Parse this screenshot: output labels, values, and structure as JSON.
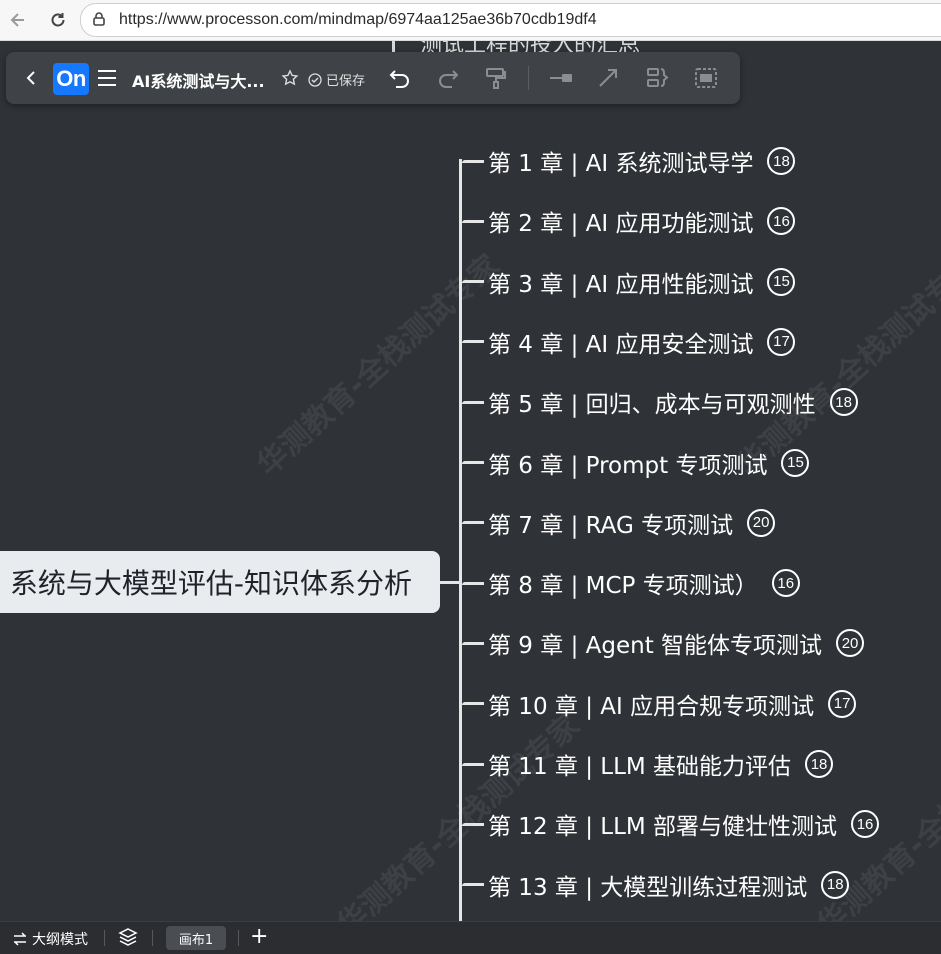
{
  "browser": {
    "url": "https://www.processon.com/mindmap/6974aa125ae36b70cdb19df4"
  },
  "toolbar": {
    "logo_text": "On",
    "title": "AI系统测试与大...",
    "saved_label": "已保存"
  },
  "canvas": {
    "watermark": "华测教育-全栈测试专家",
    "partial_top_text": "测试工程的投入的汇总",
    "root_label": "系统与大模型评估-知识体系分析",
    "chapters": [
      {
        "label": "第 1 章 | AI 系统测试导学",
        "count": "18"
      },
      {
        "label": "第 2 章 | AI 应用功能测试",
        "count": "16"
      },
      {
        "label": "第 3 章 | AI 应用性能测试",
        "count": "15"
      },
      {
        "label": "第 4 章 | AI 应用安全测试",
        "count": "17"
      },
      {
        "label": "第 5 章 | 回归、成本与可观测性",
        "count": "18"
      },
      {
        "label": "第 6 章 | Prompt 专项测试",
        "count": "15"
      },
      {
        "label": "第 7 章 | RAG 专项测试",
        "count": "20"
      },
      {
        "label": "第 8 章 | MCP 专项测试）",
        "count": "16"
      },
      {
        "label": "第 9 章 | Agent 智能体专项测试",
        "count": "20"
      },
      {
        "label": "第 10 章 | AI 应用合规专项测试",
        "count": "17"
      },
      {
        "label": "第 11 章 | LLM 基础能力评估",
        "count": "18"
      },
      {
        "label": "第 12 章 | LLM 部署与健壮性测试",
        "count": "16"
      },
      {
        "label": "第 13 章 | 大模型训练过程测试",
        "count": "18"
      }
    ]
  },
  "statusbar": {
    "outline_mode": "大纲模式",
    "canvas_tab": "画布1",
    "add_tab": "+"
  },
  "colors": {
    "canvas_bg": "#2f3236",
    "toolbar_bg": "#3f4247",
    "logo_blue": "#1677ff",
    "root_bg": "#e9ecef"
  }
}
